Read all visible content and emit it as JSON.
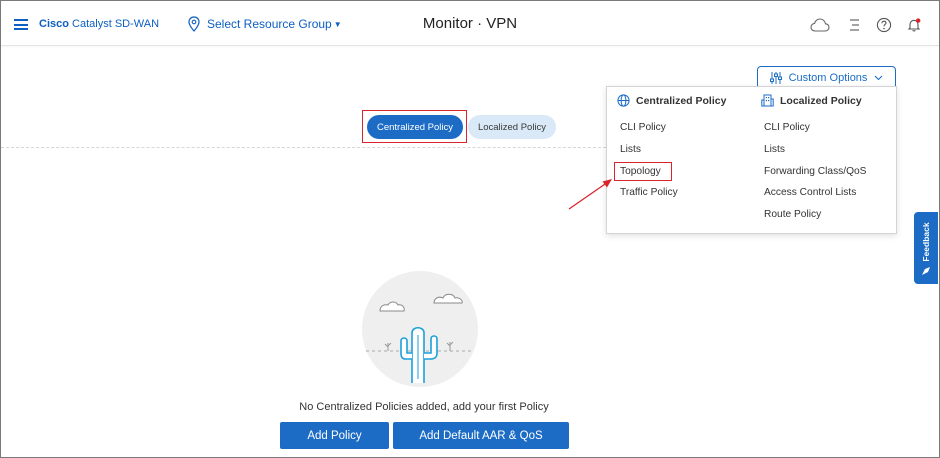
{
  "header": {
    "brand_bold": "Cisco",
    "brand_rest": " Catalyst SD-WAN",
    "resource_group": "Select Resource Group",
    "title": "Monitor · VPN",
    "accent": "#0d5fc2"
  },
  "policy_toggle": {
    "centralized": "Centralized Policy",
    "localized": "Localized Policy",
    "selected": "centralized"
  },
  "custom_options": {
    "label": "Custom Options",
    "centralized": {
      "heading": "Centralized Policy",
      "items": [
        "CLI Policy",
        "Lists",
        "Topology",
        "Traffic Policy"
      ]
    },
    "localized": {
      "heading": "Localized Policy",
      "items": [
        "CLI Policy",
        "Lists",
        "Forwarding Class/QoS",
        "Access Control Lists",
        "Route Policy"
      ]
    }
  },
  "feedback": {
    "label": "Feedback"
  },
  "empty_state": {
    "message": "No Centralized Policies added, add your first Policy",
    "add_policy": "Add Policy",
    "add_default": "Add Default AAR & QoS"
  },
  "colors": {
    "primary": "#1c6cc5",
    "highlight": "#d9242b",
    "illustration": "#1ba0d8"
  },
  "icons": [
    "menu-icon",
    "location-pin-icon",
    "cloud-icon",
    "list-icon",
    "help-icon",
    "bell-icon",
    "settings-sliders-icon",
    "chevron-down-icon",
    "globe-icon",
    "building-icon",
    "megaphone-icon",
    "cactus-illustration"
  ]
}
